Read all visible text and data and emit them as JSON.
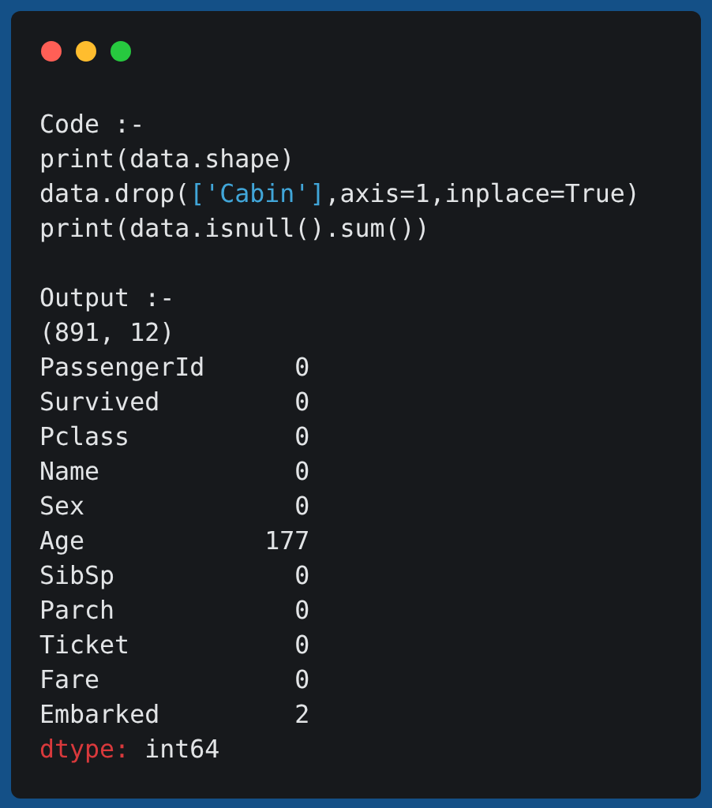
{
  "window": {
    "controls": [
      {
        "color": "#ff5f56"
      },
      {
        "color": "#ffbd2e"
      },
      {
        "color": "#27c93f"
      }
    ]
  },
  "code": {
    "label": "Code :-",
    "lines": [
      [
        {
          "kind": "plain",
          "text": "print(data.shape)"
        }
      ],
      [
        {
          "kind": "plain",
          "text": "data.drop("
        },
        {
          "kind": "string",
          "text": "['Cabin']"
        },
        {
          "kind": "plain",
          "text": ",axis=1,inplace=True)"
        }
      ],
      [
        {
          "kind": "plain",
          "text": "print(data.isnull().sum())"
        }
      ]
    ]
  },
  "output": {
    "label": "Output :-",
    "shape": "(891, 12)",
    "rows": [
      {
        "name": "PassengerId",
        "value": "0"
      },
      {
        "name": "Survived",
        "value": "0"
      },
      {
        "name": "Pclass",
        "value": "0"
      },
      {
        "name": "Name",
        "value": "0"
      },
      {
        "name": "Sex",
        "value": "0"
      },
      {
        "name": "Age",
        "value": "177"
      },
      {
        "name": "SibSp",
        "value": "0"
      },
      {
        "name": "Parch",
        "value": "0"
      },
      {
        "name": "Ticket",
        "value": "0"
      },
      {
        "name": "Fare",
        "value": "0"
      },
      {
        "name": "Embarked",
        "value": "2"
      }
    ],
    "dtype": {
      "key": "dtype:",
      "value": "int64"
    }
  }
}
